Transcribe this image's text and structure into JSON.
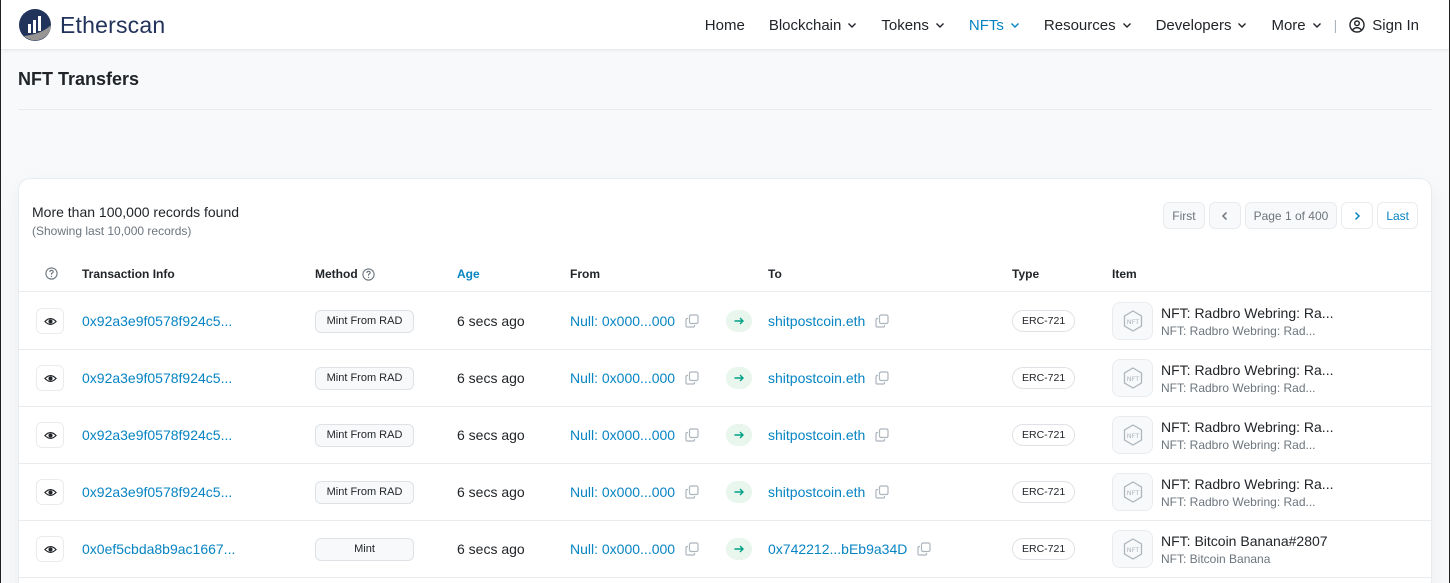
{
  "header": {
    "logo_text": "Etherscan",
    "nav": [
      {
        "label": "Home",
        "dropdown": false,
        "active": false
      },
      {
        "label": "Blockchain",
        "dropdown": true,
        "active": false
      },
      {
        "label": "Tokens",
        "dropdown": true,
        "active": false
      },
      {
        "label": "NFTs",
        "dropdown": true,
        "active": true
      },
      {
        "label": "Resources",
        "dropdown": true,
        "active": false
      },
      {
        "label": "Developers",
        "dropdown": true,
        "active": false
      },
      {
        "label": "More",
        "dropdown": true,
        "active": false
      }
    ],
    "separator": "|",
    "signin_label": "Sign In"
  },
  "page": {
    "title": "NFT Transfers"
  },
  "records": {
    "title": "More than 100,000 records found",
    "subtitle": "(Showing last 10,000 records)"
  },
  "pagination": {
    "first": "First",
    "page_label": "Page 1 of 400",
    "last": "Last"
  },
  "table": {
    "columns": {
      "txn": "Transaction Info",
      "method": "Method",
      "age": "Age",
      "from": "From",
      "to": "To",
      "type": "Type",
      "item": "Item"
    },
    "rows": [
      {
        "txn": "0x92a3e9f0578f924c5...",
        "method": "Mint From RAD",
        "age": "6 secs ago",
        "from": "Null: 0x000...000",
        "to": "shitpostcoin.eth",
        "type": "ERC-721",
        "item_name": "NFT: Radbro Webring: Ra...",
        "item_sub": "NFT: Radbro Webring: Rad..."
      },
      {
        "txn": "0x92a3e9f0578f924c5...",
        "method": "Mint From RAD",
        "age": "6 secs ago",
        "from": "Null: 0x000...000",
        "to": "shitpostcoin.eth",
        "type": "ERC-721",
        "item_name": "NFT: Radbro Webring: Ra...",
        "item_sub": "NFT: Radbro Webring: Rad..."
      },
      {
        "txn": "0x92a3e9f0578f924c5...",
        "method": "Mint From RAD",
        "age": "6 secs ago",
        "from": "Null: 0x000...000",
        "to": "shitpostcoin.eth",
        "type": "ERC-721",
        "item_name": "NFT: Radbro Webring: Ra...",
        "item_sub": "NFT: Radbro Webring: Rad..."
      },
      {
        "txn": "0x92a3e9f0578f924c5...",
        "method": "Mint From RAD",
        "age": "6 secs ago",
        "from": "Null: 0x000...000",
        "to": "shitpostcoin.eth",
        "type": "ERC-721",
        "item_name": "NFT: Radbro Webring: Ra...",
        "item_sub": "NFT: Radbro Webring: Rad..."
      },
      {
        "txn": "0x0ef5cbda8b9ac1667...",
        "method": "Mint",
        "age": "6 secs ago",
        "from": "Null: 0x000...000",
        "to": "0x742212...bEb9a34D",
        "type": "ERC-721",
        "item_name": "NFT: Bitcoin Banana#2807",
        "item_sub": "NFT: Bitcoin Banana"
      }
    ]
  },
  "icons": {
    "logo": "etherscan-logo-icon",
    "chevron": "chevron-down-icon",
    "user": "user-circle-icon",
    "eye": "eye-icon",
    "copy": "copy-icon",
    "arrow": "arrow-right-icon",
    "nft": "nft-placeholder-icon",
    "help": "question-circle-icon"
  },
  "colors": {
    "accent": "#0784c3",
    "brand_dark": "#21325b",
    "success_bg": "#e8f6ee",
    "success": "#00a186"
  }
}
